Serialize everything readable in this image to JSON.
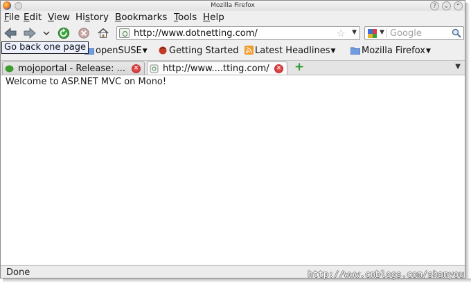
{
  "window": {
    "title": "Mozilla Firefox"
  },
  "menu": {
    "items": [
      {
        "prefix": "",
        "underline": "F",
        "rest": "ile"
      },
      {
        "prefix": "",
        "underline": "E",
        "rest": "dit"
      },
      {
        "prefix": "",
        "underline": "V",
        "rest": "iew"
      },
      {
        "prefix": "Hi",
        "underline": "s",
        "rest": "tory"
      },
      {
        "prefix": "",
        "underline": "B",
        "rest": "ookmarks"
      },
      {
        "prefix": "",
        "underline": "T",
        "rest": "ools"
      },
      {
        "prefix": "",
        "underline": "H",
        "rest": "elp"
      }
    ]
  },
  "navigation": {
    "url": "http://www.dotnetting.com/",
    "search_placeholder": "Google"
  },
  "tooltip": {
    "text": "Go back one page"
  },
  "bookmarks": {
    "items": [
      {
        "label": "openSUSE",
        "icon": "folder-icon"
      },
      {
        "label": "Getting Started",
        "icon": "firefox-icon"
      },
      {
        "label": "Latest Headlines",
        "icon": "rss-feed-icon"
      },
      {
        "label": "Mozilla Firefox",
        "icon": "folder-icon"
      }
    ]
  },
  "tabs": {
    "items": [
      {
        "label": "mojoportal - Release: ...",
        "active": false
      },
      {
        "label": "http://www....tting.com/",
        "active": true
      }
    ]
  },
  "page": {
    "body_text": "Welcome to ASP.NET MVC on Mono!"
  },
  "status": {
    "text": "Done"
  },
  "watermark": {
    "text": "http://www.cnblogs.com/shanyou"
  },
  "colors": {
    "accent": "#2f9a2f",
    "close_red": "#c62424",
    "tooltip_bg": "#ecf0ff"
  }
}
